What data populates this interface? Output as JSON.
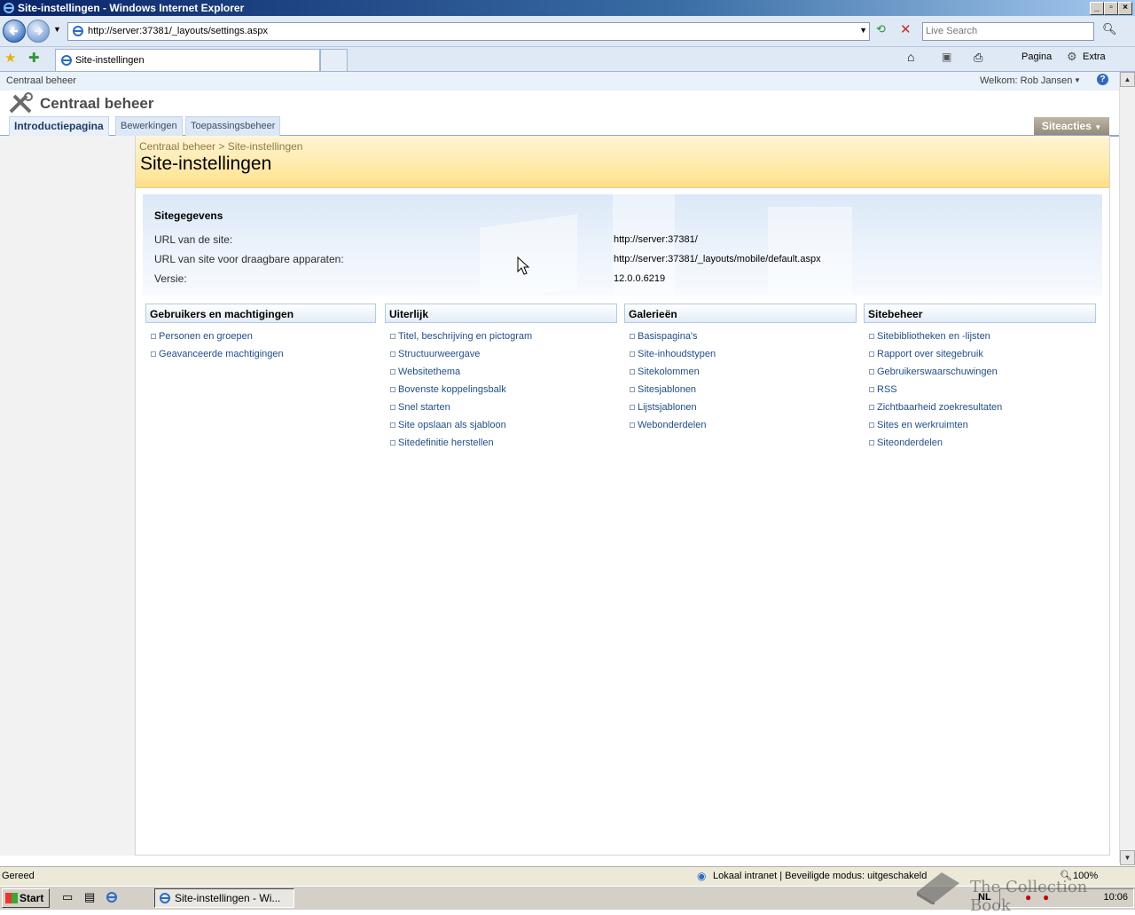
{
  "window": {
    "title": "Site-instellingen - Windows Internet Explorer"
  },
  "browser": {
    "address": "http://server:37381/_layouts/settings.aspx",
    "search_placeholder": "Live Search",
    "tab_title": "Site-instellingen",
    "toolbar": {
      "pagina": "Pagina",
      "extra": "Extra"
    }
  },
  "sharepoint": {
    "top_breadcrumb": "Centraal beheer",
    "welcome": "Welkom: Rob Jansen",
    "site_title": "Centraal beheer",
    "nav_tabs": [
      "Introductiepagina",
      "Bewerkingen",
      "Toepassingsbeheer"
    ],
    "site_actions": "Siteacties",
    "breadcrumb": {
      "root": "Centraal beheer",
      "sep": ">",
      "current": "Site-instellingen"
    },
    "page_title": "Site-instellingen"
  },
  "site_info": {
    "heading": "Sitegegevens",
    "rows": [
      {
        "label": "URL van de site:",
        "value": "http://server:37381/"
      },
      {
        "label": "URL van site voor draagbare apparaten:",
        "value": "http://server:37381/_layouts/mobile/default.aspx"
      },
      {
        "label": "Versie:",
        "value": "12.0.0.6219"
      }
    ]
  },
  "categories": [
    {
      "title": "Gebruikers en machtigingen",
      "links": [
        "Personen en groepen",
        "Geavanceerde machtigingen"
      ]
    },
    {
      "title": "Uiterlijk",
      "links": [
        "Titel, beschrijving en pictogram",
        "Structuurweergave",
        "Websitethema",
        "Bovenste koppelingsbalk",
        "Snel starten",
        "Site opslaan als sjabloon",
        "Sitedefinitie herstellen"
      ]
    },
    {
      "title": "Galerieën",
      "links": [
        "Basispagina's",
        "Site-inhoudstypen",
        "Sitekolommen",
        "Sitesjablonen",
        "Lijstsjablonen",
        "Webonderdelen"
      ]
    },
    {
      "title": "Sitebeheer",
      "links": [
        "Sitebibliotheken en -lijsten",
        "Rapport over sitegebruik",
        "Gebruikerswaarschuwingen",
        "RSS",
        "Zichtbaarheid zoekresultaten",
        "Sites en werkruimten",
        "Siteonderdelen"
      ]
    }
  ],
  "statusbar": {
    "status": "Gereed",
    "zone": "Lokaal intranet | Beveiligde modus: uitgeschakeld",
    "zoom": "100%"
  },
  "taskbar": {
    "start": "Start",
    "task": "Site-instellingen - Wi...",
    "lang": "NL",
    "clock": "10:06"
  },
  "watermark": "The Collection Book",
  "colors": {
    "link": "#1f4d8c",
    "title_band": "#ffe69a",
    "titlebar": "#0a246a"
  }
}
